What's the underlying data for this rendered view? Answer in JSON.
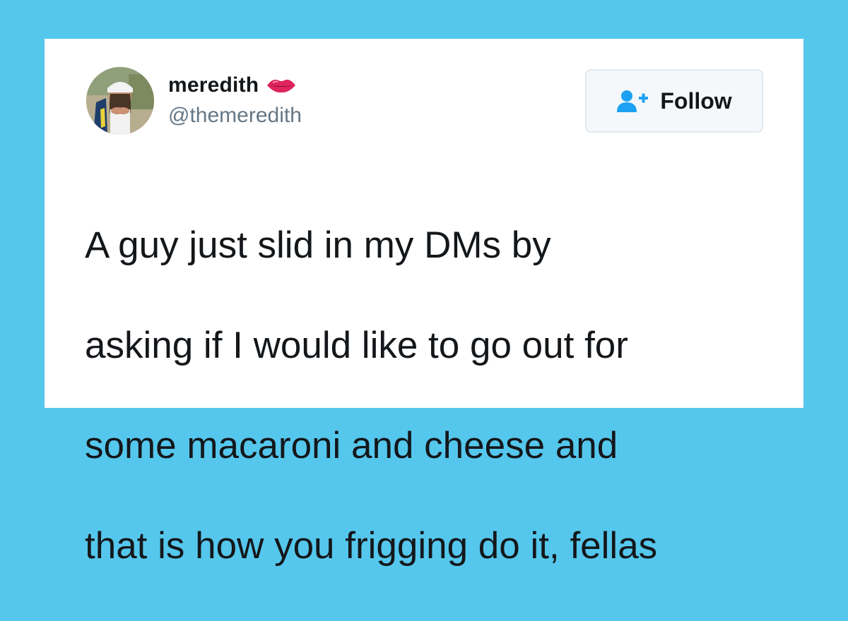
{
  "colors": {
    "background": "#55c7ed",
    "card": "#ffffff",
    "text_primary": "#14171a",
    "text_secondary": "#657786",
    "follow_icon": "#1da1f2",
    "lips": "#e0245e"
  },
  "tweet": {
    "user": {
      "display_name": "meredith",
      "name_emoji_icon": "lips-icon",
      "handle": "@themeredith",
      "avatar_icon": "profile-photo"
    },
    "follow": {
      "label": "Follow",
      "icon": "add-user-icon"
    },
    "lines": [
      "A guy just slid in my DMs by",
      "asking if I would like to go out for",
      "some macaroni and cheese and",
      "that is how you frigging do it, fellas"
    ]
  }
}
